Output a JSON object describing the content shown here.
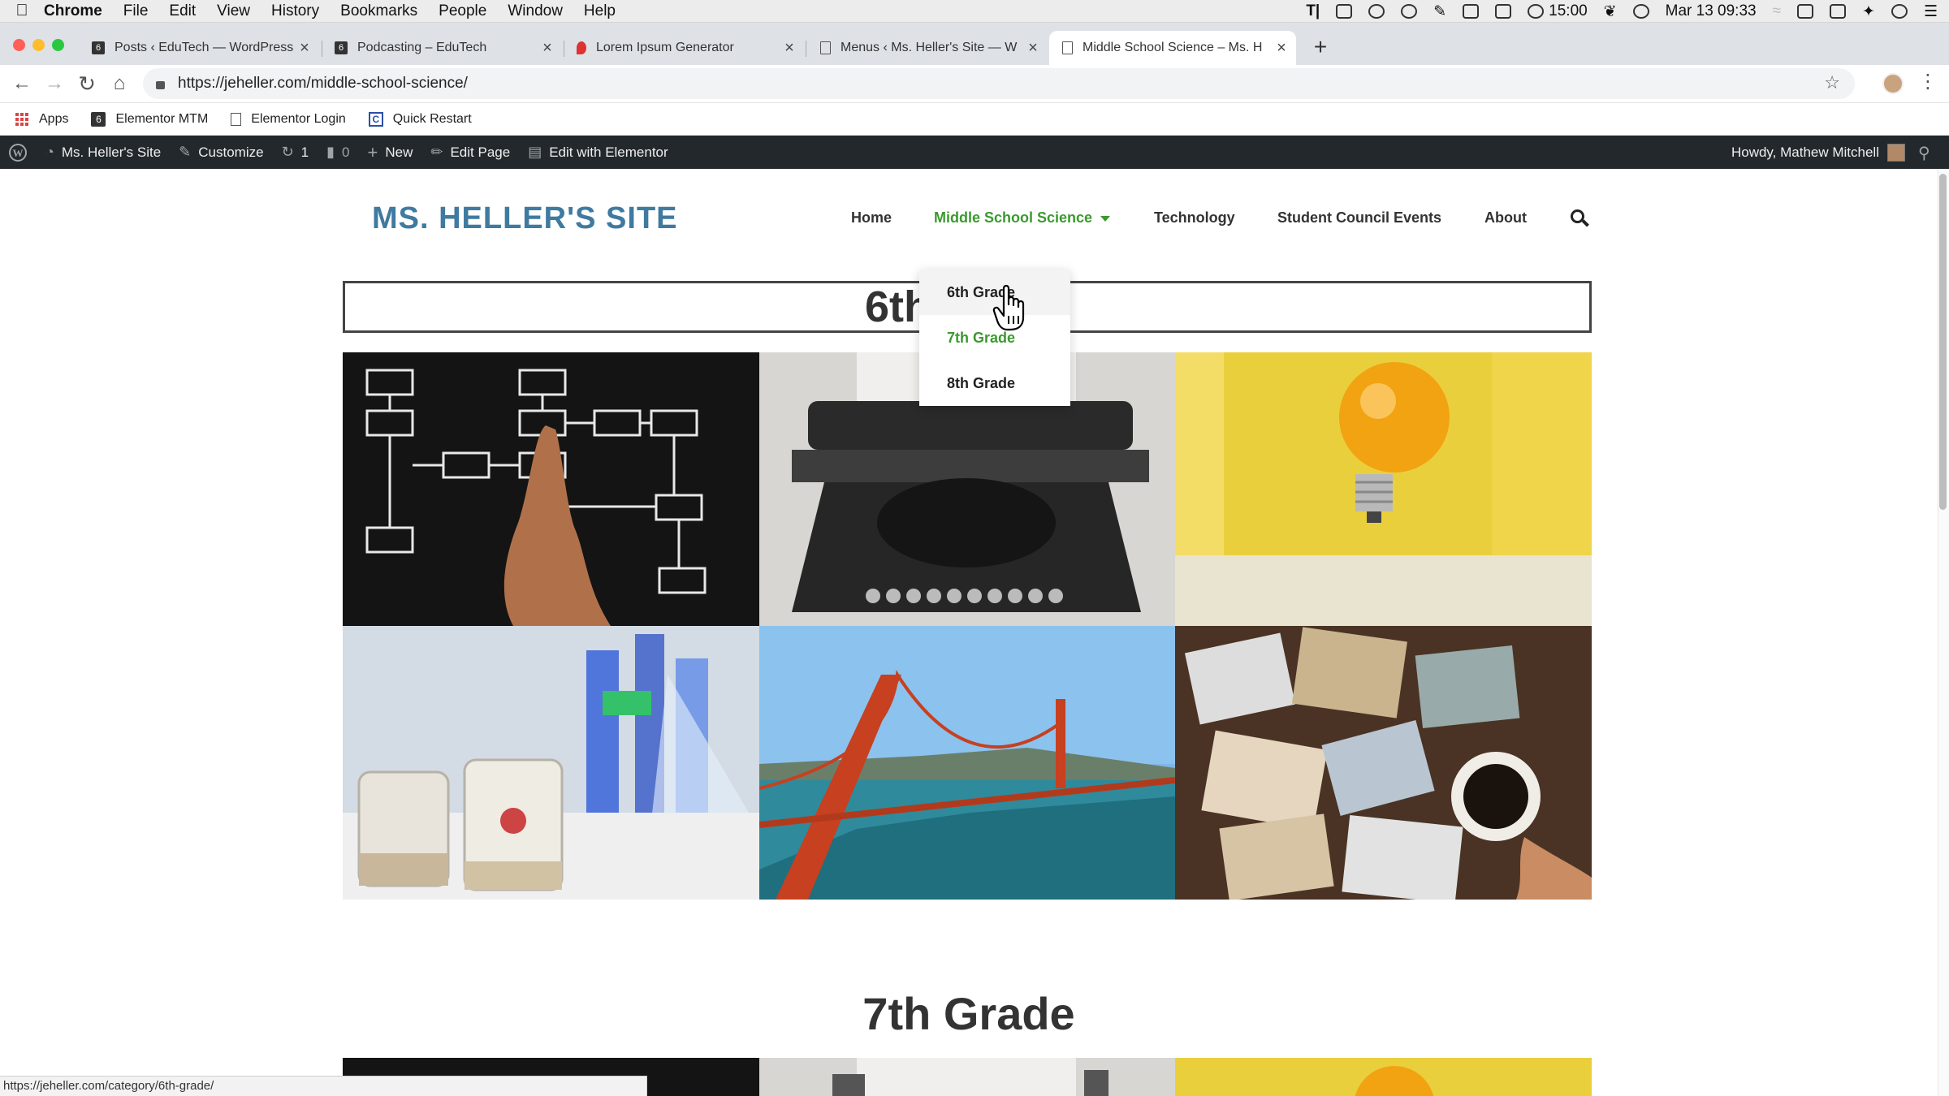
{
  "mac_menu": {
    "app_name": "Chrome",
    "items": [
      "File",
      "Edit",
      "View",
      "History",
      "Bookmarks",
      "People",
      "Window",
      "Help"
    ],
    "battery_time": "15:00",
    "clock": "Mar 13  09:33"
  },
  "browser": {
    "tabs": [
      {
        "title": "Posts ‹ EduTech — WordPress",
        "favicon": "edutech-favicon"
      },
      {
        "title": "Podcasting – EduTech",
        "favicon": "edutech-favicon"
      },
      {
        "title": "Lorem Ipsum Generator",
        "favicon": "lorem-favicon"
      },
      {
        "title": "Menus ‹ Ms. Heller's Site — W",
        "favicon": "document-icon"
      },
      {
        "title": "Middle School Science – Ms. H",
        "favicon": "document-icon",
        "active": true
      }
    ],
    "url": "https://jeheller.com/middle-school-science/",
    "bookmarks": [
      {
        "label": "Apps"
      },
      {
        "label": "Elementor MTM"
      },
      {
        "label": "Elementor Login"
      },
      {
        "label": "Quick Restart"
      }
    ],
    "status_url": "https://jeheller.com/category/6th-grade/"
  },
  "admin_bar": {
    "site_name": "Ms. Heller's Site",
    "customize": "Customize",
    "updates_count": "1",
    "comments_count": "0",
    "new_label": "New",
    "edit_page": "Edit Page",
    "edit_elementor": "Edit with Elementor",
    "howdy": "Howdy, Mathew Mitchell"
  },
  "site": {
    "title": "MS. HELLER'S SITE",
    "nav": [
      {
        "label": "Home"
      },
      {
        "label": "Middle School Science",
        "current": true
      },
      {
        "label": "Technology"
      },
      {
        "label": "Student Council Events"
      },
      {
        "label": "About"
      }
    ],
    "dropdown": [
      "6th Grade",
      "7th Grade",
      "8th Grade"
    ],
    "section1_heading": "6th Grade",
    "section2_heading": "7th Grade"
  },
  "colors": {
    "site_title": "#3f7aa0",
    "nav_active": "#3a9a2e",
    "admin_bar_bg": "#23282d"
  }
}
